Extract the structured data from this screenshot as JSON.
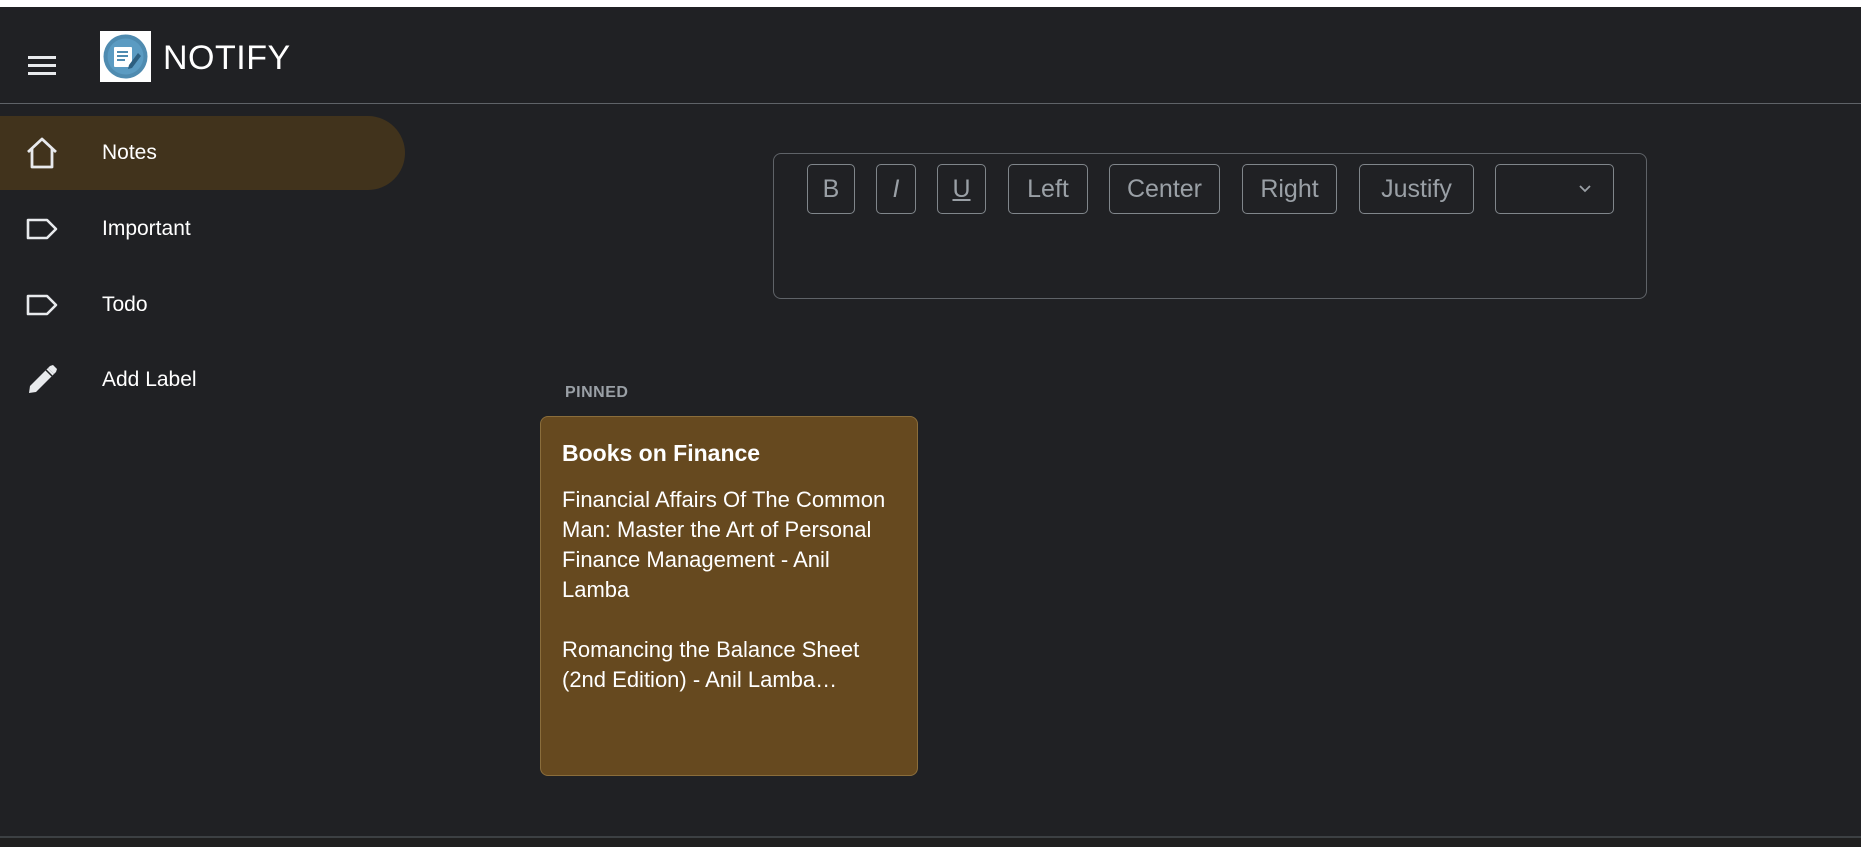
{
  "app": {
    "title": "NOTIFY",
    "logo_icon": "note-pencil-logo-icon"
  },
  "header": {
    "menu_icon": "hamburger-menu-icon"
  },
  "sidebar": {
    "active_color": "#41331c",
    "items": [
      {
        "label": "Notes",
        "icon": "home-icon",
        "active": true
      },
      {
        "label": "Important",
        "icon": "label-icon",
        "active": false
      },
      {
        "label": "Todo",
        "icon": "label-icon",
        "active": false
      },
      {
        "label": "Add Label",
        "icon": "pencil-icon",
        "active": false
      }
    ]
  },
  "editor": {
    "toolbar": {
      "bold": "B",
      "italic": "I",
      "underline": "U",
      "left": "Left",
      "center": "Center",
      "right": "Right",
      "justify": "Justify",
      "select_value": ""
    }
  },
  "notes": {
    "pinned_heading": "PINNED",
    "card_color": "#66491f",
    "pinned": [
      {
        "title": "Books on Finance",
        "body": "Financial Affairs Of The Common Man: Master the Art of Personal Finance Management - Anil Lamba\n\nRomancing the Balance Sheet (2nd Edition) - Anil Lamba…"
      }
    ]
  }
}
